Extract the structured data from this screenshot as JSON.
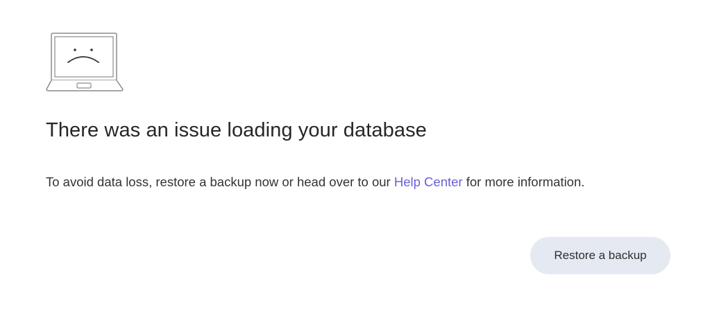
{
  "illustration": {
    "icon": "sad-laptop-icon"
  },
  "error": {
    "title": "There was an issue loading your database",
    "message_before": "To avoid data loss, restore a backup now or head over to our ",
    "link_label": "Help Center",
    "message_after": " for more information."
  },
  "actions": {
    "restore_label": "Restore a backup"
  },
  "colors": {
    "link": "#6a5fd8",
    "button_bg": "#e5e9f2",
    "text": "#262626"
  }
}
